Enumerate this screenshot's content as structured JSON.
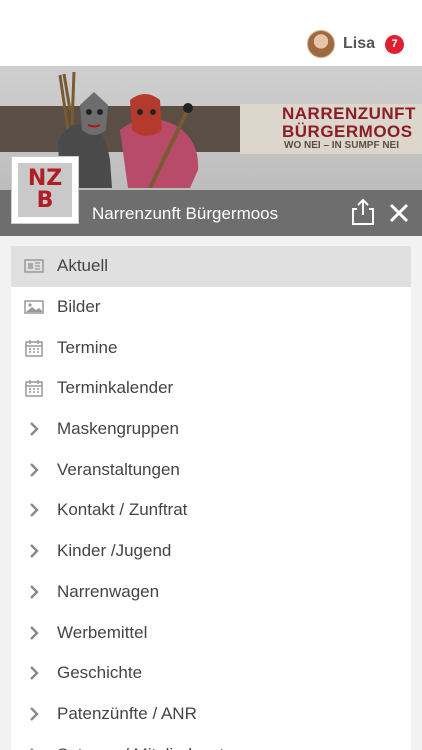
{
  "user": {
    "name": "Lisa",
    "notifications": "7"
  },
  "banner": {
    "title_line1": "NARRENZUNFT",
    "title_line2": "BÜRGERMOOS",
    "tagline": "WO NEI – IN SUMPF NEI"
  },
  "club": {
    "logo_line1": "NZ",
    "logo_line2": "B",
    "name": "Narrenzunft Bürgermoos"
  },
  "menu": {
    "items": [
      {
        "label": "Aktuell",
        "icon": "newspaper-icon",
        "active": true
      },
      {
        "label": "Bilder",
        "icon": "image-icon"
      },
      {
        "label": "Termine",
        "icon": "calendar-icon"
      },
      {
        "label": "Terminkalender",
        "icon": "calendar-icon"
      },
      {
        "label": "Maskengruppen",
        "icon": "chevron-right-icon"
      },
      {
        "label": "Veranstaltungen",
        "icon": "chevron-right-icon"
      },
      {
        "label": "Kontakt / Zunftrat",
        "icon": "chevron-right-icon"
      },
      {
        "label": "Kinder /Jugend",
        "icon": "chevron-right-icon"
      },
      {
        "label": "Narrenwagen",
        "icon": "chevron-right-icon"
      },
      {
        "label": "Werbemittel",
        "icon": "chevron-right-icon"
      },
      {
        "label": "Geschichte",
        "icon": "chevron-right-icon"
      },
      {
        "label": "Patenzünfte / ANR",
        "icon": "chevron-right-icon"
      },
      {
        "label": "Satzung / Mitgliedsantrag",
        "icon": "chevron-right-icon"
      }
    ]
  },
  "colors": {
    "title_bar": "#6e6e6e",
    "badge": "#e02030",
    "brand_red": "#8a1e24",
    "active_item": "#e0e0e0"
  }
}
